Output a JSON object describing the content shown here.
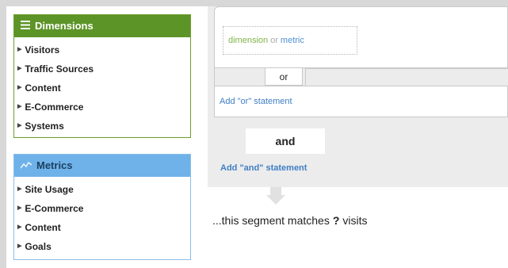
{
  "dimensions": {
    "title": "Dimensions",
    "icon": "list-icon",
    "items": [
      "Visitors",
      "Traffic Sources",
      "Content",
      "E-Commerce",
      "Systems"
    ]
  },
  "metrics": {
    "title": "Metrics",
    "icon": "chart-line-icon",
    "items": [
      "Site Usage",
      "E-Commerce",
      "Content",
      "Goals"
    ]
  },
  "builder": {
    "condition": {
      "dimension": "dimension",
      "separator": "or",
      "metric": "metric"
    },
    "or_label": "or",
    "add_or": "Add \"or\" statement",
    "and_label": "and",
    "add_and": "Add \"and\" statement"
  },
  "summary": {
    "prefix": "...this segment matches",
    "count": "?",
    "suffix": "visits"
  },
  "colors": {
    "dimensions_header": "#5d9427",
    "metrics_header": "#6fb2ea",
    "link": "#3f7ec4"
  }
}
